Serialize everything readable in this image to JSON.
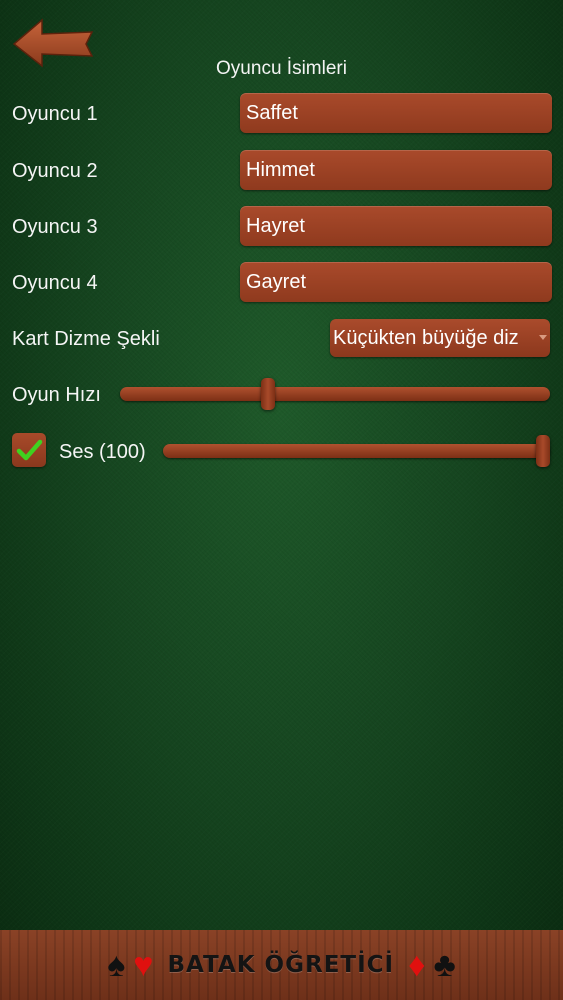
{
  "header": {
    "title": "Oyuncu İsimleri"
  },
  "players": [
    {
      "label": "Oyuncu 1",
      "value": "Saffet"
    },
    {
      "label": "Oyuncu 2",
      "value": "Himmet"
    },
    {
      "label": "Oyuncu 3",
      "value": "Hayret"
    },
    {
      "label": "Oyuncu 4",
      "value": "Gayret"
    }
  ],
  "card_sort": {
    "label": "Kart Dizme Şekli",
    "selected": "Küçükten büyüğe diz"
  },
  "game_speed": {
    "label": "Oyun Hızı",
    "level": 0.34
  },
  "sound": {
    "label": "Ses (100)",
    "enabled": true,
    "level": 100
  },
  "footer": {
    "title": "BATAK ÖĞRETİCİ"
  },
  "icons": {
    "back": "back-arrow-icon",
    "check": "checkmark-icon",
    "spade": "♠",
    "heart": "♥",
    "diamond": "♦",
    "club": "♣"
  },
  "colors": {
    "felt": "#164620",
    "wood": "#9c4224",
    "check": "#3fd11f",
    "suit_red": "#e0100f"
  }
}
